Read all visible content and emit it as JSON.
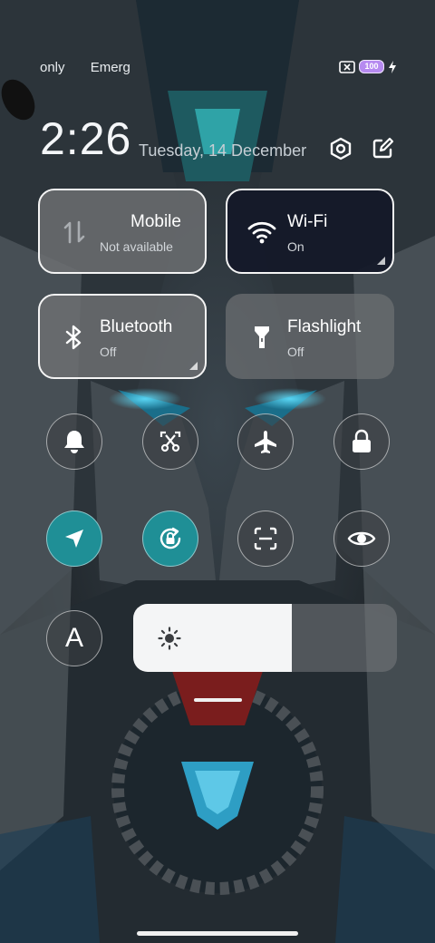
{
  "status_bar": {
    "left_items": [
      "only",
      "Emerg"
    ],
    "battery_level": "100",
    "icons": [
      "sim-disabled-icon",
      "battery-icon",
      "charging-bolt-icon"
    ]
  },
  "header": {
    "time": "2:26",
    "date": "Tuesday, 14 December",
    "icons": [
      "settings-hexagon-icon",
      "edit-icon"
    ]
  },
  "tiles": [
    {
      "title": "Mobile",
      "subtitle": "Not available",
      "state": "off",
      "icon": "mobile-data-icon"
    },
    {
      "title": "Wi-Fi",
      "subtitle": "On",
      "state": "on",
      "icon": "wifi-icon"
    },
    {
      "title": "Bluetooth",
      "subtitle": "Off",
      "state": "off",
      "icon": "bluetooth-icon"
    },
    {
      "title": "Flashlight",
      "subtitle": "Off",
      "state": "off",
      "icon": "flashlight-icon"
    }
  ],
  "toggles_row1": [
    {
      "name": "ring",
      "icon": "bell-icon",
      "active": false
    },
    {
      "name": "screenshot",
      "icon": "scissors-screenshot-icon",
      "active": false
    },
    {
      "name": "airplane-mode",
      "icon": "airplane-icon",
      "active": false
    },
    {
      "name": "lock-screen",
      "icon": "lock-icon",
      "active": false
    }
  ],
  "toggles_row2": [
    {
      "name": "location",
      "icon": "location-arrow-icon",
      "active": true
    },
    {
      "name": "rotation-lock",
      "icon": "rotation-lock-icon",
      "active": true
    },
    {
      "name": "scanner",
      "icon": "scan-icon",
      "active": false
    },
    {
      "name": "reading-mode",
      "icon": "eye-icon",
      "active": false
    }
  ],
  "auto_brightness": {
    "label": "A",
    "active": false
  },
  "brightness": {
    "level": 0.6,
    "icon": "sun-icon"
  },
  "colors": {
    "accent": "#1f8f96",
    "tile_on": "#141828",
    "tile_off": "#6e7073",
    "battery": "#b68af0"
  }
}
